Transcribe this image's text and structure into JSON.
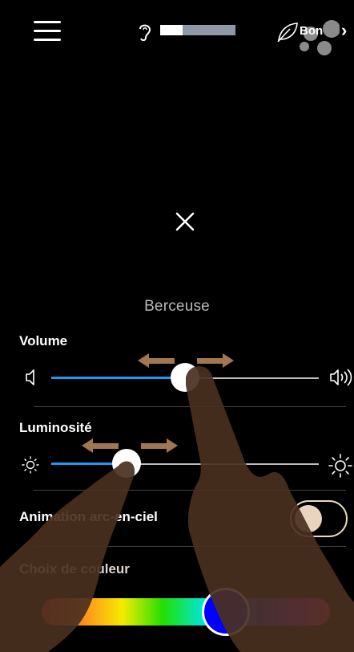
{
  "header": {
    "menu_icon": "hamburger-menu-icon",
    "noise_icon": "ear-icon",
    "noise_level": 0.3,
    "air_icon": "leaf-icon",
    "air_quality_label": "Bon",
    "chevron_icon": "chevron-right-icon"
  },
  "main": {
    "close_icon": "close-icon",
    "track_name": "Berceuse"
  },
  "volume": {
    "label": "Volume",
    "value": 0.5,
    "min_icon": "speaker-low-icon",
    "max_icon": "speaker-high-icon"
  },
  "brightness": {
    "label": "Luminosité",
    "value": 0.28,
    "min_icon": "sun-low-icon",
    "max_icon": "sun-high-icon"
  },
  "rainbow_animation": {
    "label": "Animation arc-en-ciel",
    "enabled": false
  },
  "color_choice": {
    "label": "Choix de couleur",
    "selected_color": "#0000ff",
    "accent": "#2196f3"
  }
}
